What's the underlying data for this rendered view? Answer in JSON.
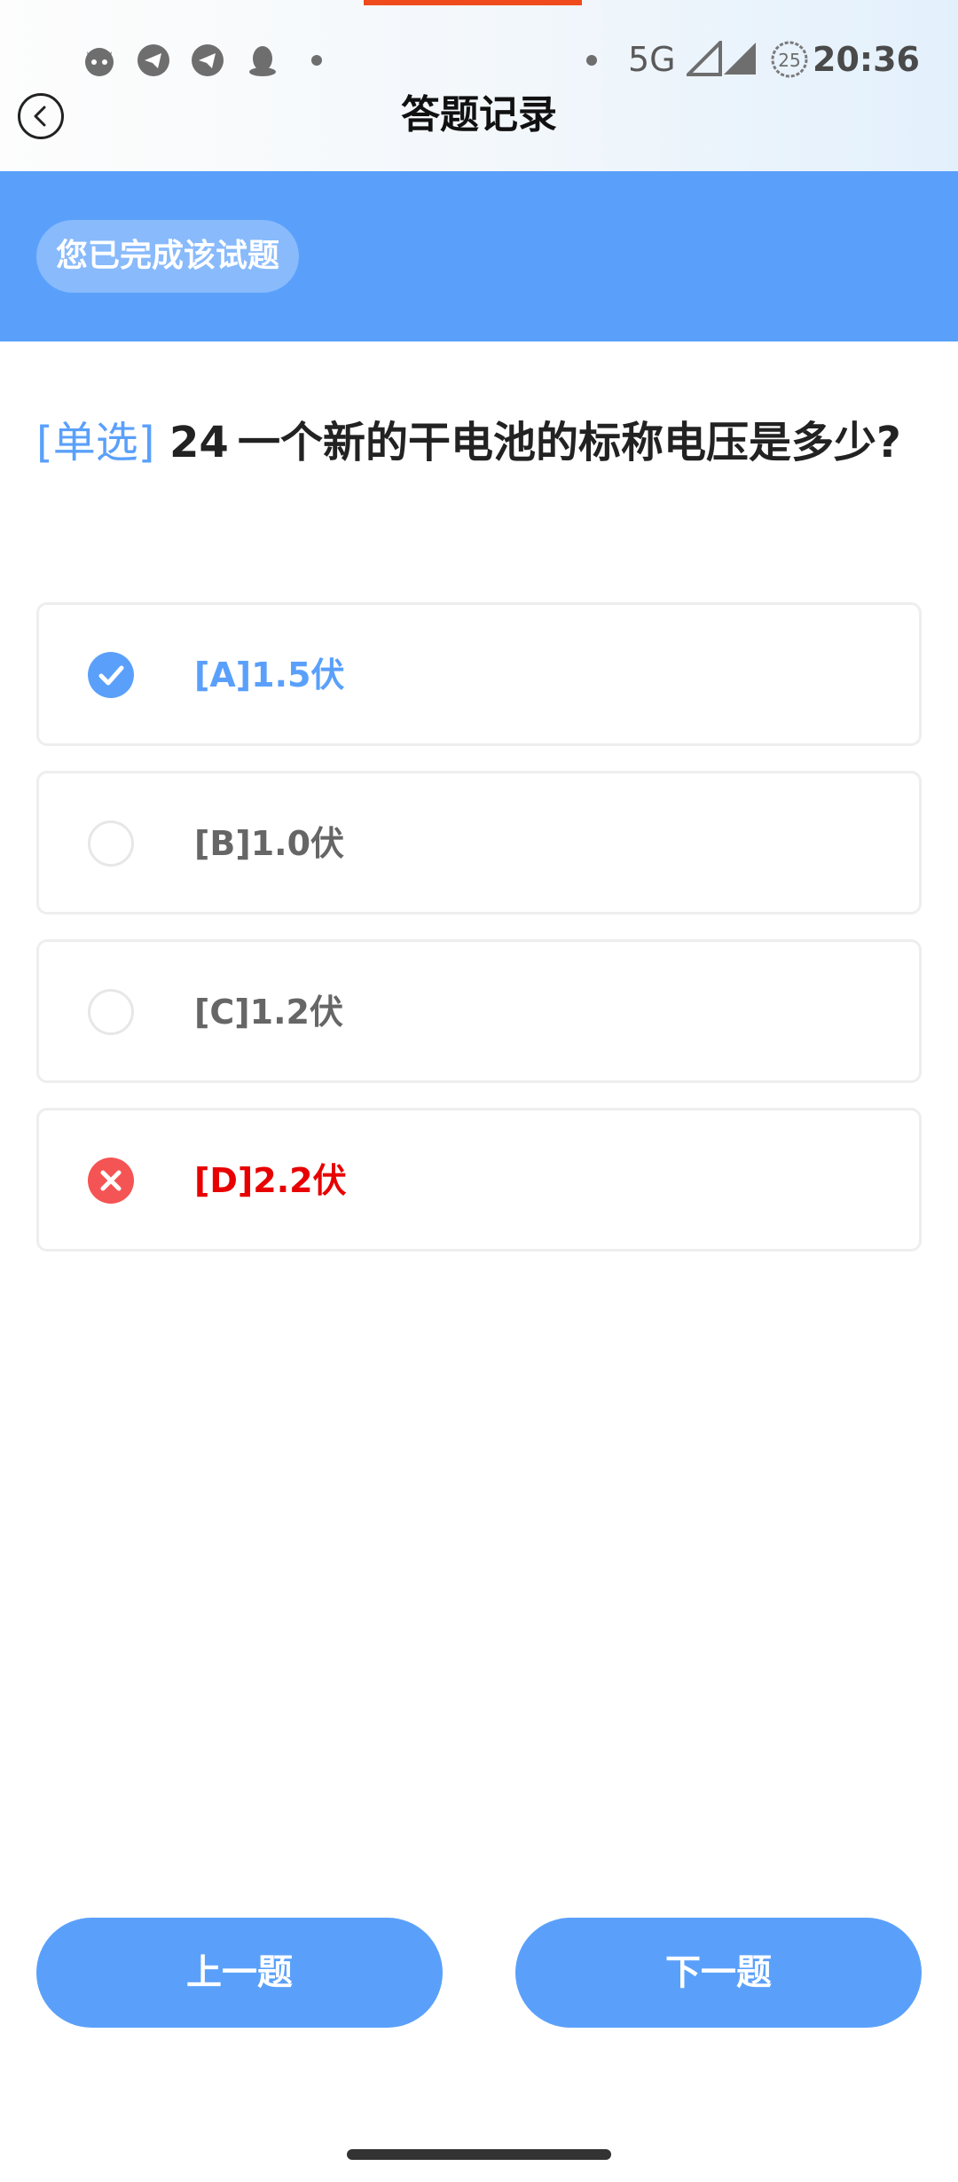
{
  "status_bar": {
    "network": "5G",
    "battery_level": "25",
    "time": "20:36"
  },
  "header": {
    "title": "答题记录"
  },
  "banner": {
    "badge": "您已完成该试题"
  },
  "question": {
    "type": "[单选]",
    "number": "24",
    "text": "一个新的干电池的标称电压是多少?"
  },
  "options": [
    {
      "label": "[A]1.5伏",
      "state": "selected-correct",
      "color": "#5aa0fb"
    },
    {
      "label": "[B]1.0伏",
      "state": "unselected",
      "color": "#666666"
    },
    {
      "label": "[C]1.2伏",
      "state": "unselected",
      "color": "#666666"
    },
    {
      "label": "[D]2.2伏",
      "state": "wrong",
      "color": "#e80000"
    }
  ],
  "footer": {
    "prev_label": "上一题",
    "next_label": "下一题"
  },
  "colors": {
    "accent": "#5aa0fb",
    "error": "#f55454",
    "top_indicator": "#ef4b1c"
  }
}
